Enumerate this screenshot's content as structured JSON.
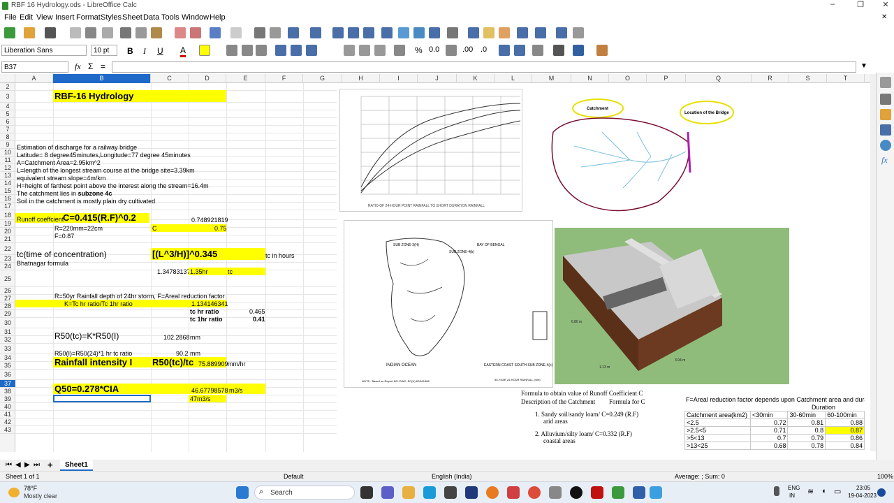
{
  "window": {
    "title": "RBF 16 Hydrology.ods - LibreOffice Calc"
  },
  "menu": [
    "File",
    "Edit",
    "View",
    "Insert",
    "Format",
    "Styles",
    "Sheet",
    "Data",
    "Tools",
    "Window",
    "Help"
  ],
  "toolbar": {
    "font_name": "Liberation Sans",
    "font_size": "10 pt"
  },
  "formula": {
    "cell_ref": "B37",
    "content": ""
  },
  "columns": [
    "A",
    "B",
    "C",
    "D",
    "E",
    "F",
    "G",
    "H",
    "I",
    "J",
    "K",
    "L",
    "M",
    "N",
    "O",
    "P",
    "Q",
    "R",
    "S",
    "T"
  ],
  "rows": [
    "2",
    "3",
    "4",
    "5",
    "6",
    "7",
    "8",
    "9",
    "10",
    "11",
    "12",
    "13",
    "14",
    "15",
    "16",
    "17",
    "18",
    "19",
    "20",
    "21",
    "22",
    "23",
    "24",
    "25",
    "26",
    "27",
    "28",
    "29",
    "30",
    "31",
    "32",
    "33",
    "34",
    "35",
    "36",
    "37",
    "38",
    "39",
    "40",
    "41",
    "42",
    "43"
  ],
  "cells": {
    "title": "RBF-16 Hydrology",
    "r9": "Estimation of discharge for a railway bridge",
    "r10": "Latitude= 8 degree45minutes,Longitude=77 degree 45minutes",
    "r11": "A=Catchment Area=2.95km^2",
    "r12": "L=length of the longest stream course at the bridge site=3.39km",
    "r13": "equivalent stream slope=4m/km",
    "r14": "H=height of farthest point above the interest along the stream=16.4m",
    "r15a": "The catchment lies in ",
    "r15b": "subzone 4c",
    "r16": "Soil in the catchment is mostly plain dry cultivated",
    "r18a": "Runoff coeffcient ",
    "r18b": "C=0.415(R.F)^0.2",
    "r18d": "0.748921819",
    "r19a": "R=220mm=22cm",
    "r19c": "C",
    "r19d": "0.75",
    "r20": "F=0.87",
    "r22a": "tc(time of concentration)",
    "r22c": "[(L^3/H)]^0.345",
    "r22f": "tc in hours",
    "r23": "Bhatnagar formula",
    "r24c": "1.34783137",
    "r24d": "1.35hr",
    "r24e": "tc",
    "r25": "R=50yr Rainfall depth of 24hr storm, F=Areal reduction factor",
    "r26b": "K=Tc hr ratio/Tc 1hr ratio",
    "r26d": "1.134146341",
    "r27d": "tc hr ratio",
    "r27e": "0.465",
    "r28d": "tc 1hr ratio",
    "r28e": "0.41",
    "r30b": "R50(tc)=K*R50(I)",
    "r30c": "102.2868",
    "r30d": "mm",
    "r32b": "R50(I)=R50(24)*1 hr tc ratio",
    "r32c": "90.2",
    "r32d": "mm",
    "r33b": "Rainfall intensity I",
    "r33c": "R50(tc)/tc",
    "r33d": "75.889909",
    "r33e": "mm/hr",
    "r36b": "Q50=0.278*CIA",
    "r36d": "46.67798578",
    "r36e": "m3/s",
    "r37d": "47m3/s"
  },
  "areal_table": {
    "title": "F=Areal reduction factor depends upon Catchment area and durati",
    "group": "Duration",
    "headers": [
      "Catchment area(km2)",
      "<30min",
      "30-60min",
      "60-100min"
    ],
    "rows": [
      [
        "<2.5",
        "0.72",
        "0.81",
        "0.88"
      ],
      [
        ">2.5<5",
        "0.71",
        "0.8",
        "0.87"
      ],
      [
        ">5<13",
        "0.7",
        "0.79",
        "0.86"
      ],
      [
        ">13<25",
        "0.68",
        "0.78",
        "0.84"
      ]
    ]
  },
  "images": {
    "catchment_label": "Catchment",
    "bridge_label": "Location of the Bridge",
    "dim1": "6.80 m",
    "dim2": "1.13 m",
    "dim3": "3.94 m",
    "runoff_title": "Formula to obtain value of Runoff Coefficient C",
    "runoff_h1": "Description of the Catchment",
    "runoff_h2": "Formula for C",
    "runoff_1": "1. Sandy soil/sandy loam/ C=0.249 (R.F)",
    "runoff_1b": "arid areas",
    "runoff_2": "2. Alluvium/silty loam/ C=0.332 (R.F)",
    "runoff_2b": "coastal areas",
    "map_zone1": "SUB ZONE-3(H)",
    "map_zone2": "SUB ZONE-4(b)",
    "map_sea": "INDIAN OCEAN",
    "map_bay": "BAY OF BENGAL",
    "map_note": "NOTE : Based on Report NO. DWC. EC(U) 6S/N/1986",
    "map_sub": "EASTERN COAST SOUTH SUB ZONE-4(c)",
    "map_sub2": "50-YEAR 24-HOUR RAINFALL (mm)",
    "chart_note": "RATIO OF 24-HOUR POINT RAINFALL TO SHORT DURATION RAINFALL"
  },
  "tabs": {
    "sheet": "Sheet1"
  },
  "status": {
    "sheet": "Sheet 1 of 1",
    "style": "Default",
    "lang": "English (India)",
    "sum": "Average: ; Sum: 0",
    "zoom": "100%"
  },
  "taskbar": {
    "temp": "78°F",
    "weather": "Mostly clear",
    "search": "Search",
    "lang1": "ENG",
    "lang2": "IN",
    "time": "23:05",
    "date": "19-04-2023"
  }
}
